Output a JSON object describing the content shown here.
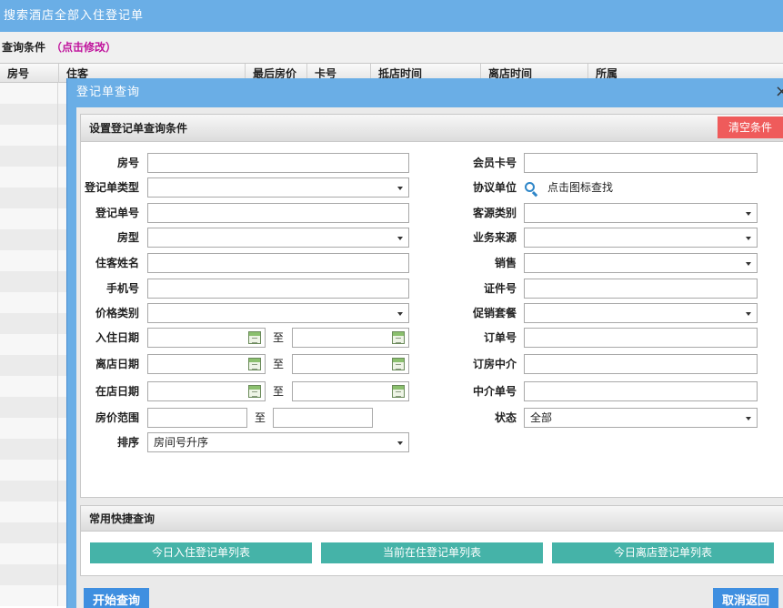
{
  "page": {
    "title": "搜索酒店全部入住登记单",
    "query_label": "查询条件",
    "query_edit": "（点击修改）",
    "columns": [
      "房号",
      "住客",
      "最后房价",
      "卡号",
      "抵店时间",
      "离店时间",
      "所属"
    ]
  },
  "dialog": {
    "title": "登记单查询",
    "close": "×",
    "conditions": {
      "header": "设置登记单查询条件",
      "clear_button": "清空条件",
      "left": {
        "room_no": "房号",
        "reg_type": "登记单类型",
        "reg_no": "登记单号",
        "room_type": "房型",
        "guest_name": "住客姓名",
        "mobile": "手机号",
        "price_type": "价格类别",
        "checkin_date": "入住日期",
        "checkout_date": "离店日期",
        "instay_date": "在店日期",
        "price_range": "房价范围",
        "sort": "排序",
        "sort_value": "房间号升序",
        "to": "至"
      },
      "right": {
        "member_card": "会员卡号",
        "agreement_unit": "协议单位",
        "agreement_hint": "点击图标查找",
        "source_type": "客源类别",
        "business_source": "业务来源",
        "sales": "销售",
        "id_no": "证件号",
        "promo_package": "促销套餐",
        "order_no": "订单号",
        "booking_agent": "订房中介",
        "agent_order_no": "中介单号",
        "status": "状态",
        "status_value": "全部"
      }
    },
    "quick": {
      "header": "常用快捷查询",
      "today_checkin": "今日入住登记单列表",
      "current_instay": "当前在住登记单列表",
      "today_checkout": "今日离店登记单列表"
    },
    "footer": {
      "start": "开始查询",
      "cancel": "取消返回"
    }
  },
  "colors": {
    "title_bar": "#6aaee6",
    "clear_button": "#ef5b5b",
    "quick_button": "#45b3a8",
    "primary_button": "#3f8fe0",
    "query_edit_link": "#c0149c"
  }
}
